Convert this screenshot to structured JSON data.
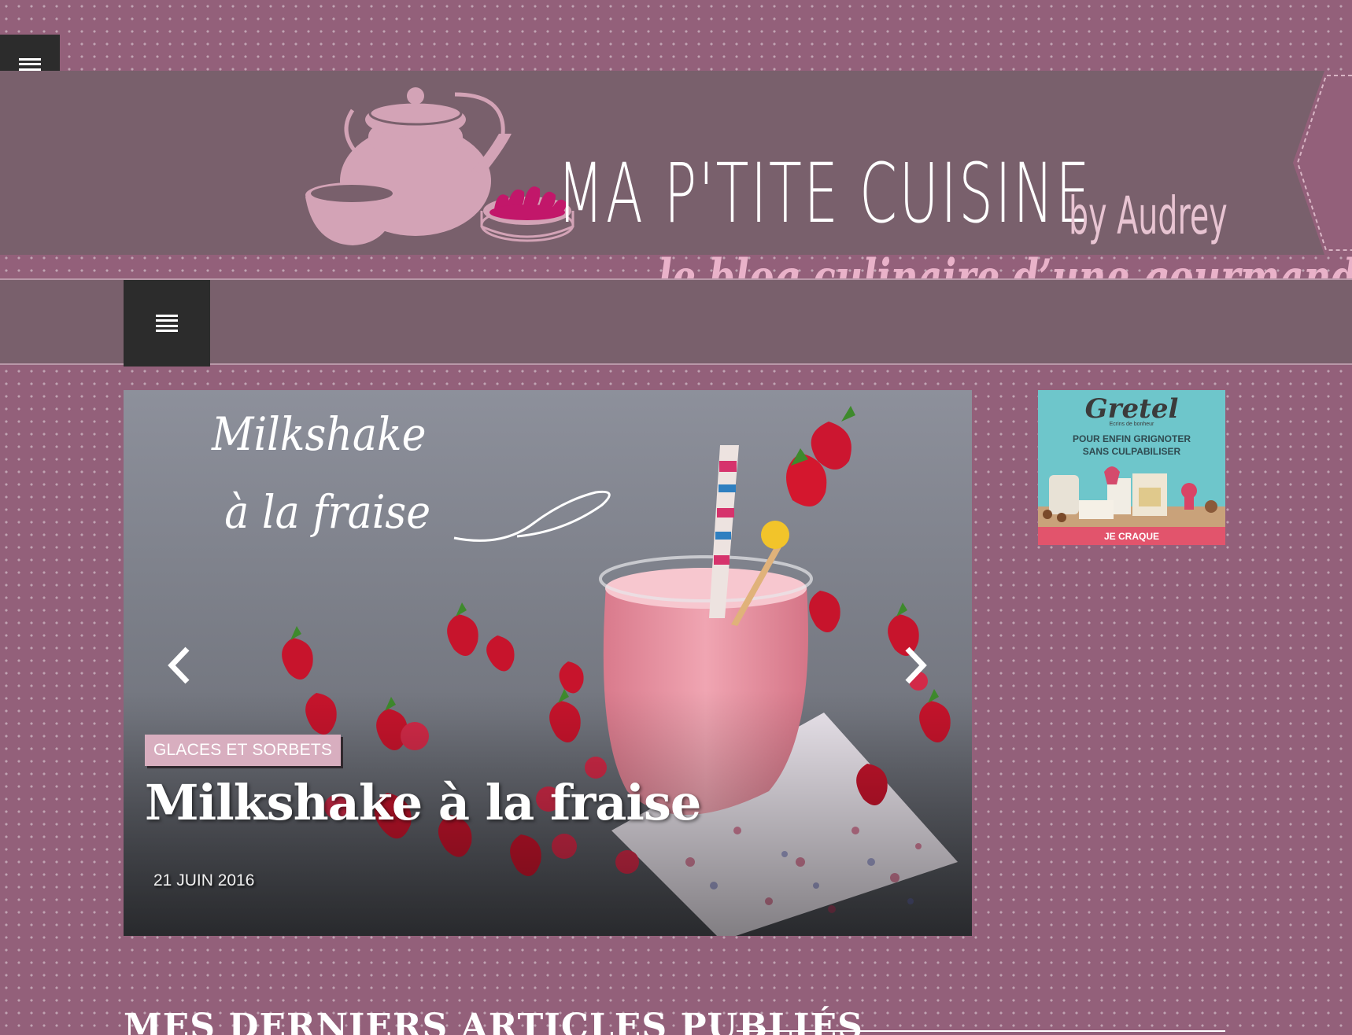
{
  "site": {
    "title": "MA P'TITE CUISINE",
    "byline": "by Audrey",
    "tagline": "le blog culinaire d’une gourmande"
  },
  "slider": {
    "image_caption_line1": "Milkshake",
    "image_caption_line2": "à la fraise",
    "category": "GLACES ET SORBETS",
    "title": "Milkshake à la fraise",
    "date": "21 JUIN 2016"
  },
  "ad": {
    "brand": "Gretel",
    "brand_sub": "Ecrins de bonheur",
    "headline_line1": "POUR ENFIN GRIGNOTER",
    "headline_line2": "SANS CULPABILISER",
    "cta": "JE CRAQUE"
  },
  "latest": {
    "heading": "MES DERNIERS ARTICLES PUBLIÉS"
  },
  "icons": {
    "menu": "menu-icon",
    "prev": "chevron-left-icon",
    "next": "chevron-right-icon"
  },
  "colors": {
    "background": "#93607a",
    "banner": "#79606c",
    "dark_button": "#2c2c2c",
    "category_badge": "#d8aebf",
    "ad_background": "#6ec6cb",
    "ad_cta": "#e2546c"
  }
}
